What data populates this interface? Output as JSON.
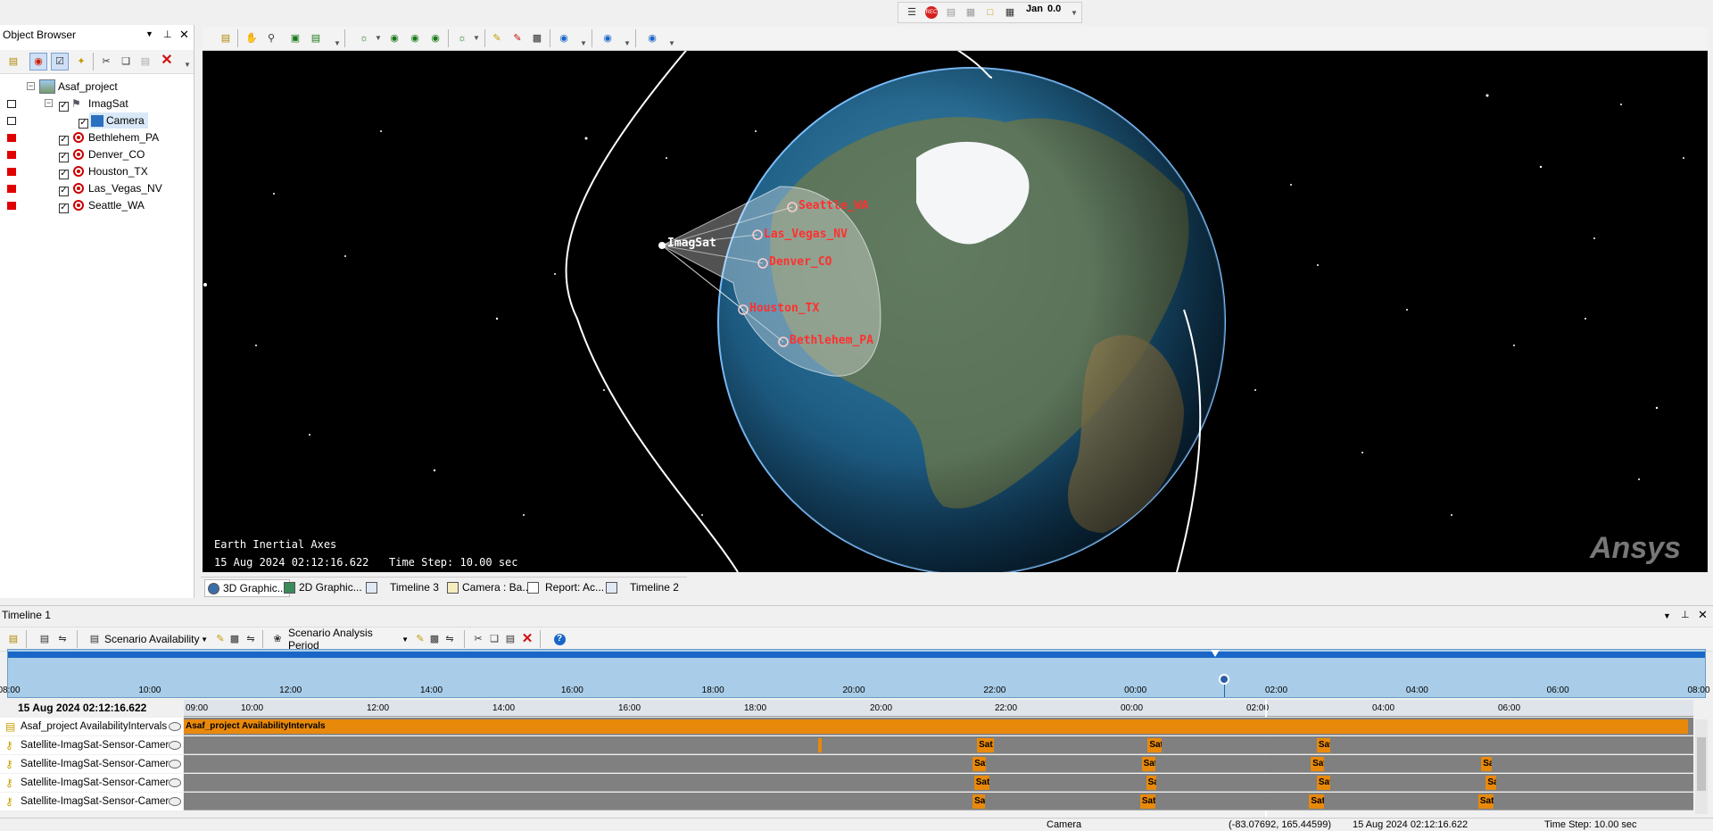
{
  "top_toolbar": {
    "icons": [
      "anim-icon",
      "record-icon",
      "chart-icon",
      "chart2-icon",
      "folder-icon",
      "calc-icon"
    ],
    "jan_label": "Jan",
    "time_label": "0.0"
  },
  "object_browser": {
    "title": "Object Browser",
    "tree": [
      {
        "label": "Asaf_project",
        "icon": "scenario-icon",
        "level": 0,
        "color": null,
        "checked": null
      },
      {
        "label": "ImagSat",
        "icon": "satellite-icon",
        "level": 1,
        "color": "#ffffff",
        "checked": true
      },
      {
        "label": "Camera",
        "icon": "sensor-icon",
        "level": 2,
        "color": "#ffffff",
        "checked": true
      },
      {
        "label": "Bethlehem_PA",
        "icon": "target-icon",
        "level": 1,
        "color": "#e00000",
        "checked": true
      },
      {
        "label": "Denver_CO",
        "icon": "target-icon",
        "level": 1,
        "color": "#e00000",
        "checked": true
      },
      {
        "label": "Houston_TX",
        "icon": "target-icon",
        "level": 1,
        "color": "#e00000",
        "checked": true
      },
      {
        "label": "Las_Vegas_NV",
        "icon": "target-icon",
        "level": 1,
        "color": "#e00000",
        "checked": true
      },
      {
        "label": "Seattle_WA",
        "icon": "target-icon",
        "level": 1,
        "color": "#e00000",
        "checked": true
      }
    ]
  },
  "view3d": {
    "satellite_label": "ImagSat",
    "targets": [
      "Seattle_WA",
      "Las_Vegas_NV",
      "Denver_CO",
      "Houston_TX",
      "Bethlehem_PA"
    ],
    "axes_label": "Earth Inertial Axes",
    "time_label": "15 Aug 2024 02:12:16.622",
    "step_label": "Time Step: 10.00 sec",
    "watermark": "Ansys",
    "label_color": "#ff3030"
  },
  "tabs": [
    {
      "label": "3D Graphic...",
      "icon": "globe-icon",
      "active": true
    },
    {
      "label": "2D Graphic...",
      "icon": "map-icon",
      "active": false
    },
    {
      "label": "Timeline 3",
      "icon": "timeline-icon",
      "active": false
    },
    {
      "label": "Camera : Ba...",
      "icon": "report-icon",
      "active": false
    },
    {
      "label": "Report: Ac...",
      "icon": "report-icon",
      "active": false
    },
    {
      "label": "Timeline 2",
      "icon": "timeline-icon",
      "active": false
    }
  ],
  "timeline": {
    "title": "Timeline 1",
    "availability_select": "Scenario Availability",
    "period_select": "Scenario Analysis Period",
    "overview_ticks": [
      "08:00",
      "10:00",
      "12:00",
      "14:00",
      "16:00",
      "18:00",
      "20:00",
      "22:00",
      "00:00",
      "02:00",
      "04:00",
      "06:00",
      "08:00"
    ],
    "current_time": "15 Aug 2024 02:12:16.622",
    "detail_ticks": [
      "09:00",
      "10:00",
      "12:00",
      "14:00",
      "16:00",
      "18:00",
      "20:00",
      "22:00",
      "00:00",
      "02:00",
      "04:00",
      "06:00"
    ],
    "rows": [
      {
        "label": "Asaf_project AvailabilityIntervals",
        "icon": "scenario-icon",
        "bars": [
          {
            "text": "Asaf_project AvailabilityIntervals",
            "start": 0.0,
            "end": 0.9965
          }
        ]
      },
      {
        "label": "Satellite-ImagSat-Sensor-Camera",
        "icon": "key-icon",
        "bars": [
          {
            "text": "",
            "start": 0.4205,
            "end": 0.4225
          },
          {
            "text": "Sat",
            "start": 0.5255,
            "end": 0.5365
          },
          {
            "text": "Sat",
            "start": 0.6385,
            "end": 0.6475
          },
          {
            "text": "Sat",
            "start": 0.7505,
            "end": 0.7595
          }
        ]
      },
      {
        "label": "Satellite-ImagSat-Sensor-Camera",
        "icon": "key-icon",
        "bars": [
          {
            "text": "Sat",
            "start": 0.5225,
            "end": 0.5315
          },
          {
            "text": "Sat",
            "start": 0.6345,
            "end": 0.6435
          },
          {
            "text": "Sat",
            "start": 0.7465,
            "end": 0.7555
          },
          {
            "text": "Sa",
            "start": 0.8595,
            "end": 0.8665
          }
        ]
      },
      {
        "label": "Satellite-ImagSat-Sensor-Camera",
        "icon": "key-icon",
        "bars": [
          {
            "text": "Sat",
            "start": 0.5235,
            "end": 0.5335
          },
          {
            "text": "Sa",
            "start": 0.6375,
            "end": 0.6445
          },
          {
            "text": "Sat",
            "start": 0.7505,
            "end": 0.7595
          },
          {
            "text": "Sa",
            "start": 0.8625,
            "end": 0.8695
          }
        ]
      },
      {
        "label": "Satellite-ImagSat-Sensor-Camera",
        "icon": "key-icon",
        "bars": [
          {
            "text": "Sa",
            "start": 0.5225,
            "end": 0.5305
          },
          {
            "text": "Sat",
            "start": 0.6335,
            "end": 0.6435
          },
          {
            "text": "Sat",
            "start": 0.7455,
            "end": 0.7555
          },
          {
            "text": "Sat",
            "start": 0.8575,
            "end": 0.8675
          }
        ]
      }
    ],
    "overview_marker_fraction": 0.721
  },
  "status_bar": {
    "object": "Camera",
    "coords": "(-83.07692, 165.44599)",
    "time": "15 Aug 2024 02:12:16.622",
    "step": "Time Step: 10.00 sec"
  },
  "colors": {
    "accent_blue": "#1a66c8",
    "timeline_band": "#a9cde8",
    "access_orange": "#e8890c",
    "track_gray": "#808080"
  }
}
